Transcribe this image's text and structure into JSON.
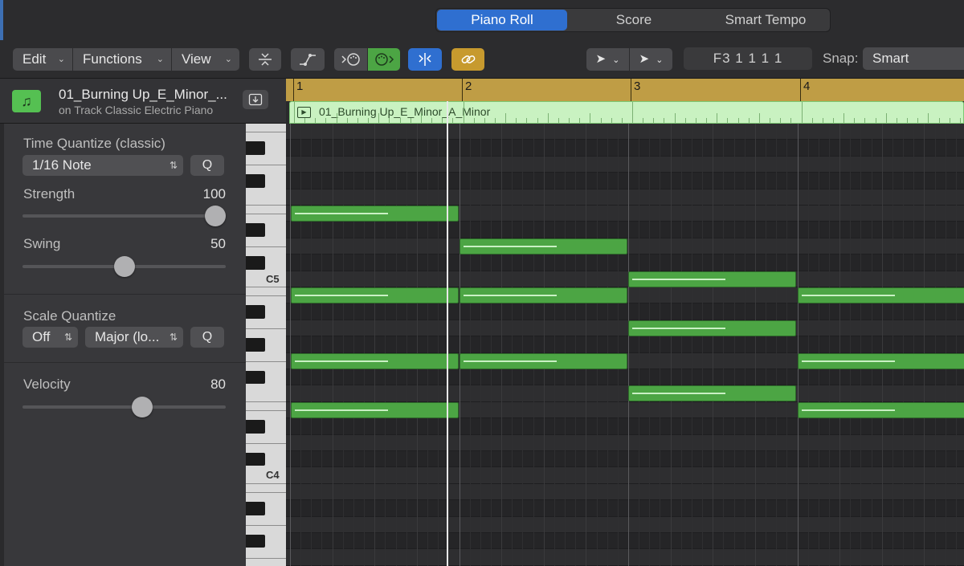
{
  "tabs": [
    {
      "label": "Piano Roll",
      "active": true
    },
    {
      "label": "Score",
      "active": false
    },
    {
      "label": "Smart Tempo",
      "active": false
    }
  ],
  "toolbar": {
    "edit_label": "Edit",
    "functions_label": "Functions",
    "view_label": "View",
    "position": "F3  1 1 1 1",
    "snap_label": "Snap:",
    "snap_value": "Smart"
  },
  "region": {
    "name": "01_Burning Up_E_Minor_...",
    "track": "on Track Classic Electric Piano",
    "full_name": "01_Burning Up_E_Minor_A_Minor"
  },
  "inspector": {
    "time_quantize_label": "Time Quantize (classic)",
    "time_quantize_value": "1/16 Note",
    "q_label": "Q",
    "strength_label": "Strength",
    "strength_value": "100",
    "strength_level": 1.0,
    "swing_label": "Swing",
    "swing_value": "50",
    "swing_level": 0.5,
    "scale_quantize_label": "Scale Quantize",
    "scale_off": "Off",
    "scale_mode": "Major (lo...",
    "velocity_label": "Velocity",
    "velocity_value": "80",
    "velocity_level": 0.6
  },
  "keyboard": {
    "labels": [
      "C5",
      "C4"
    ]
  },
  "ruler": {
    "bars": [
      "1",
      "2",
      "3",
      "4"
    ]
  },
  "colors": {
    "accent": "#2f6fd0",
    "note": "#4ca544",
    "ruler": "#bf9d45",
    "region": "#c9f2c1"
  }
}
